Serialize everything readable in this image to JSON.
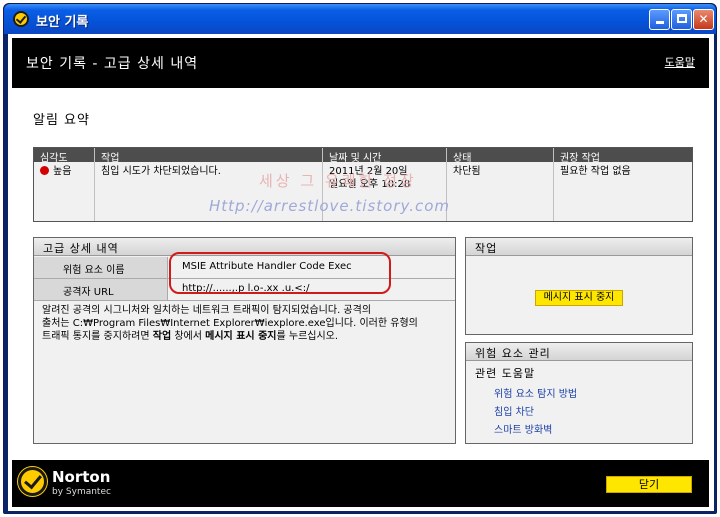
{
  "window": {
    "title": "보안 기록",
    "controls": {
      "minimize": "minimize",
      "maximize": "maximize",
      "close": "✕"
    }
  },
  "header": {
    "title": "보안 기록 - 고급 상세 내역",
    "help_link": "도움말"
  },
  "summary": {
    "title": "알림 요약",
    "columns": {
      "severity": "심각도",
      "task": "작업",
      "datetime": "날짜 및 시간",
      "status": "상태",
      "recommended": "권장 작업"
    },
    "row": {
      "severity": "높음",
      "severity_color": "#d40000",
      "task": "침입 시도가 차단되었습니다.",
      "date": "2011년 2월 20일",
      "time": "일요일 오후 10:28",
      "status": "차단됨",
      "recommended": "필요한 작업 없음"
    }
  },
  "advanced": {
    "title": "고급 상세 내역",
    "threat_name_label": "위험 요소 이름",
    "threat_name_value": "MSIE Attribute Handler Code Exec",
    "attacker_url_label": "공격자 URL",
    "attacker_url_value": "http://......,.p l.o-.xx  .u.<:/",
    "description_line1": "알려진 공격의 시그니처와 일치하는 네트워크 트래픽이 탐지되었습니다. 공격의",
    "description_line2": "출처는 C:₩Program Files₩Internet Explorer₩iexplore.exe입니다. 이러한 유형의",
    "description_line3_pre": "트래픽 통지를 중지하려면 ",
    "description_bold1": "작업",
    "description_mid": " 창에서 ",
    "description_bold2": "메시지 표시 중지",
    "description_post": "를 누르십시오."
  },
  "action": {
    "title": "작업",
    "stop_button": "메시지 표시 중지"
  },
  "threat_mgmt": {
    "title": "위험 요소 관리",
    "subtitle": "관련 도움말",
    "links": [
      "위험 요소 탐지 방법",
      "침입 차단",
      "스마트 방화벽"
    ]
  },
  "footer": {
    "brand": "Norton",
    "brand_sub": "by Symantec",
    "close_button": "닫기"
  },
  "watermark": {
    "line1": "세상 그 유쾌한 정장",
    "line2": "Http://arrestlove.tistory.com"
  },
  "colors": {
    "title_bar": "#0553d8",
    "header_band": "#000000",
    "accent_yellow": "#ffe600",
    "severity_high": "#d40000",
    "highlight_outline": "#d11a1a",
    "link": "#1a3fa6"
  }
}
